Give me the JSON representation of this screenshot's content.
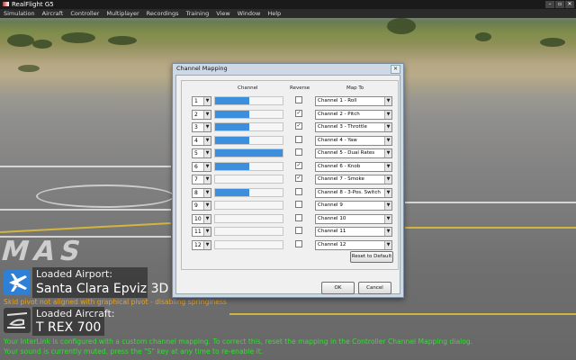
{
  "app": {
    "title": "RealFlight G5",
    "window_controls": [
      "–",
      "▫",
      "✕"
    ]
  },
  "menu": [
    "Simulation",
    "Aircraft",
    "Controller",
    "Multiplayer",
    "Recordings",
    "Training",
    "View",
    "Window",
    "Help"
  ],
  "dialog": {
    "title": "Channel Mapping",
    "close_label": "✕",
    "headers": {
      "channel": "Channel",
      "reverse": "Reverse",
      "map_to": "Map To"
    },
    "rows": [
      {
        "num": "1",
        "fill": 0.5,
        "reverse": false,
        "map": "Channel 1 - Roll"
      },
      {
        "num": "2",
        "fill": 0.5,
        "reverse": true,
        "map": "Channel 2 - Pitch"
      },
      {
        "num": "3",
        "fill": 0.5,
        "reverse": true,
        "map": "Channel 3 - Throttle"
      },
      {
        "num": "4",
        "fill": 0.5,
        "reverse": false,
        "map": "Channel 4 - Yaw"
      },
      {
        "num": "5",
        "fill": 1.0,
        "reverse": false,
        "map": "Channel 5 - Dual Rates"
      },
      {
        "num": "6",
        "fill": 0.5,
        "reverse": true,
        "map": "Channel 6 - Knob"
      },
      {
        "num": "7",
        "fill": 0.0,
        "reverse": true,
        "map": "Channel 7 - Smoke"
      },
      {
        "num": "8",
        "fill": 0.5,
        "reverse": false,
        "map": "Channel 8 - 3-Pos. Switch"
      },
      {
        "num": "9",
        "fill": 0.0,
        "reverse": false,
        "map": "Channel 9"
      },
      {
        "num": "10",
        "fill": 0.0,
        "reverse": false,
        "map": "Channel 10"
      },
      {
        "num": "11",
        "fill": 0.0,
        "reverse": false,
        "map": "Channel 11"
      },
      {
        "num": "12",
        "fill": 0.0,
        "reverse": false,
        "map": "Channel 12"
      }
    ],
    "reset_label": "Reset to Default",
    "ok_label": "OK",
    "cancel_label": "Cancel"
  },
  "overlay": {
    "airport_title": "Loaded Airport:",
    "airport_name": "Santa Clara Epviz 3D",
    "warning": "Skid pivot not aligned with graphical pivot - disabling springiness",
    "aircraft_title": "Loaded Aircraft:",
    "aircraft_name": "T REX 700",
    "message1": "Your InterLink is configured with a custom channel mapping.  To correct this, reset the mapping in the Controller Channel Mapping dialog.",
    "message2": "Your sound is currently muted, press the \"S\" key at any time to re-enable it."
  },
  "colors": {
    "bar_fill": "#3b8fdd",
    "warning_text": "#e8a020",
    "info_text": "#2ee02e"
  },
  "icons": {
    "airport": "airplane-icon",
    "aircraft": "helicopter-icon",
    "dropdown": "chevron-down-icon"
  }
}
